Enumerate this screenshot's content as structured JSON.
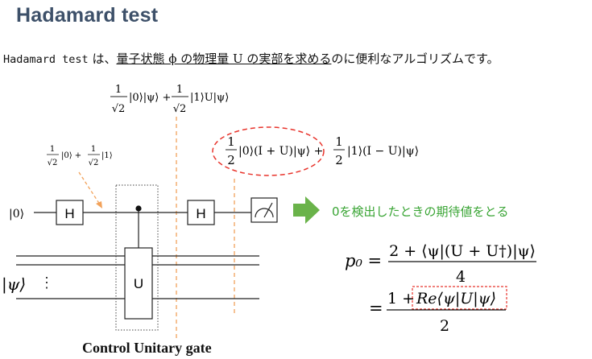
{
  "title": "Hadamard test",
  "intro": {
    "name": "Hadamard test",
    "part1": " は、",
    "underlined": "量子状態 ϕ の物理量 U の実部を求める",
    "part2": "のに便利なアルゴリズムです。"
  },
  "circuit": {
    "input_ancilla": "|0⟩",
    "input_target": "|ψ⟩",
    "gate_h1": "H",
    "gate_h2": "H",
    "gate_u": "U",
    "dots": "⋮"
  },
  "states": {
    "small_num_1": "1",
    "small_den_1": "√2",
    "small_ket_1": "|0⟩ +",
    "small_num_2": "1",
    "small_den_2": "√2",
    "small_ket_2": "|1⟩",
    "mid_num_1": "1",
    "mid_den_1": "√2",
    "mid_ket_1": "|0⟩|ψ⟩ +",
    "mid_num_2": "1",
    "mid_den_2": "√2",
    "mid_ket_2": "|1⟩U|ψ⟩",
    "final_num_1": "1",
    "final_den_1": "2",
    "final_ket_1": "|0⟩(I + U)|ψ⟩ +",
    "final_num_2": "1",
    "final_den_2": "2",
    "final_ket_2": "|1⟩(I − U)|ψ⟩"
  },
  "arrow_note": "0を検出したときの期待値をとる",
  "formula": {
    "lhs": "p₀ =",
    "num1": "2 + ⟨ψ|(U + U†)|ψ⟩",
    "den1": "4",
    "eq2": "=",
    "num2_prefix": "1 +",
    "num2_boxed": "Re⟨ψ|U|ψ⟩",
    "den2": "2"
  },
  "caption": "Control Unitary gate",
  "colors": {
    "title": "#3d5069",
    "dashed_red": "#e8342c",
    "dashed_orange": "#f2a25a",
    "green_arrow": "#6ab34a",
    "green_text": "#3aa535"
  }
}
